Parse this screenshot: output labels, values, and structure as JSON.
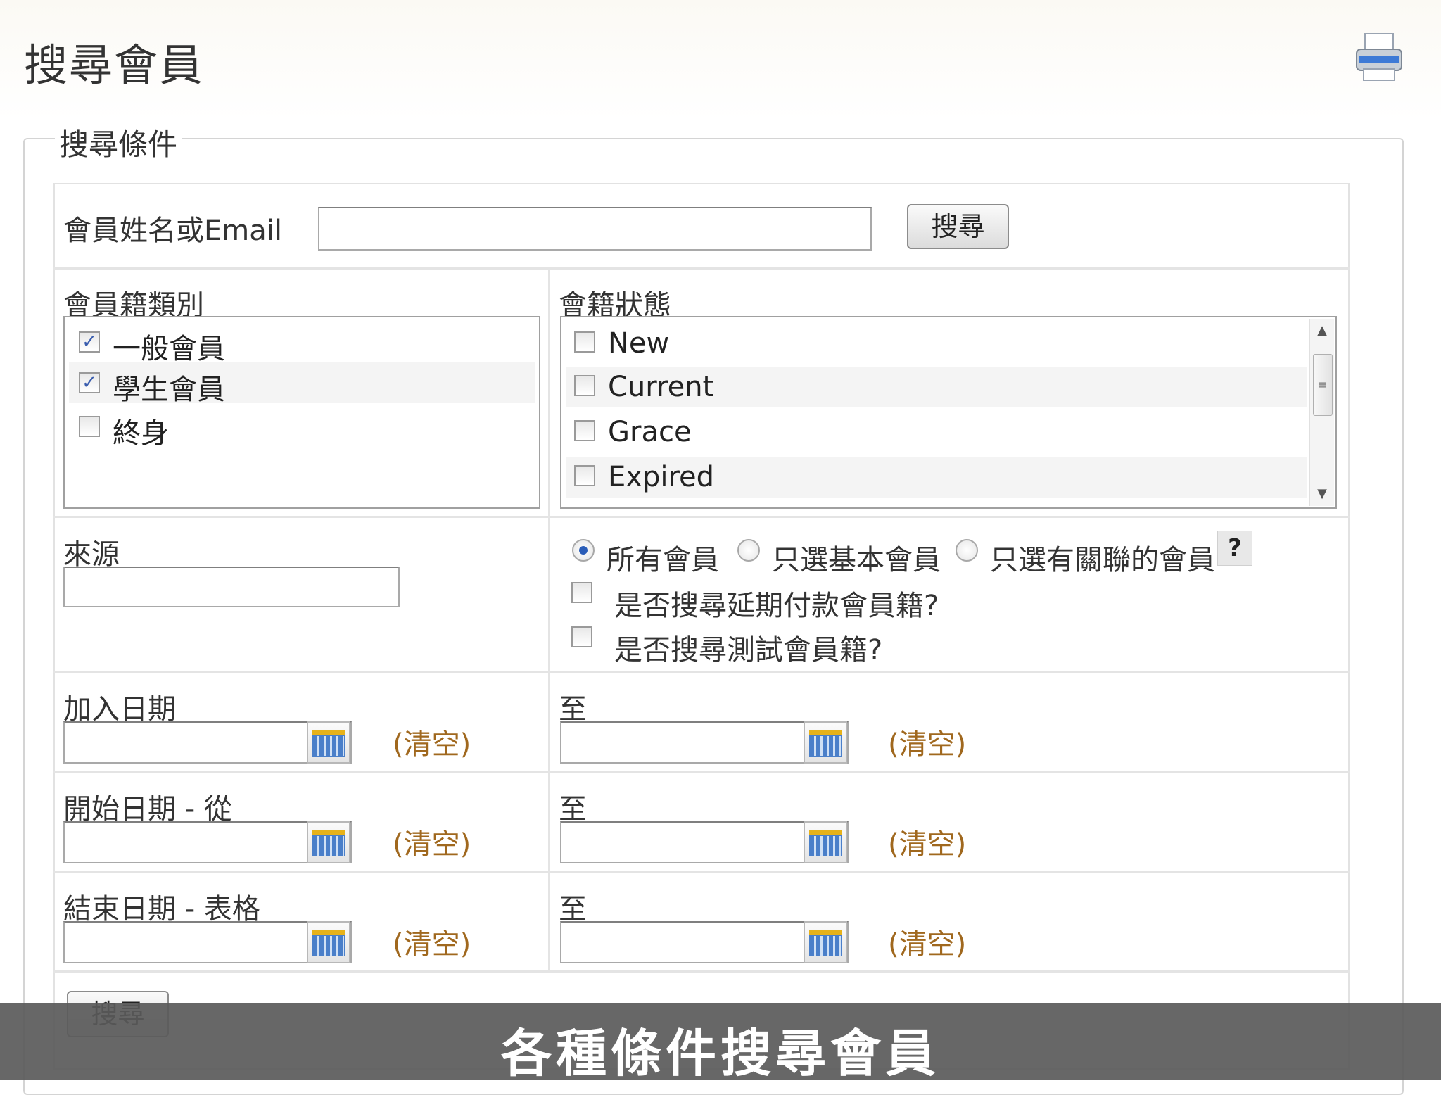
{
  "page": {
    "title": "搜尋會員"
  },
  "fieldset": {
    "legend": "搜尋條件"
  },
  "search_row": {
    "label": "會員姓名或Email",
    "value": "",
    "button_label": "搜尋"
  },
  "membership_type": {
    "label": "會員籍類別",
    "options": [
      {
        "label": "一般會員",
        "checked": true
      },
      {
        "label": "學生會員",
        "checked": true
      },
      {
        "label": "終身",
        "checked": false
      }
    ]
  },
  "membership_status": {
    "label": "會籍狀態",
    "options": [
      {
        "label": "New",
        "checked": false
      },
      {
        "label": "Current",
        "checked": false
      },
      {
        "label": "Grace",
        "checked": false
      },
      {
        "label": "Expired",
        "checked": false
      }
    ]
  },
  "source": {
    "label": "來源",
    "value": ""
  },
  "member_scope": {
    "options": [
      {
        "label": "所有會員",
        "selected": true
      },
      {
        "label": "只選基本會員",
        "selected": false
      },
      {
        "label": "只選有關聯的會員",
        "selected": false
      }
    ],
    "help": "?",
    "deferred_payment_label": "是否搜尋延期付款會員籍?",
    "test_membership_label": "是否搜尋測試會員籍?"
  },
  "date_rows": [
    {
      "from_label": "加入日期",
      "to_label": "至",
      "clear_label": "(清空)"
    },
    {
      "from_label": "開始日期 - 從",
      "to_label": "至",
      "clear_label": "(清空)"
    },
    {
      "from_label": "結束日期 - 表格",
      "to_label": "至",
      "clear_label": "(清空)"
    }
  ],
  "bottom_button_label": "搜尋",
  "caption": "各種條件搜尋會員"
}
